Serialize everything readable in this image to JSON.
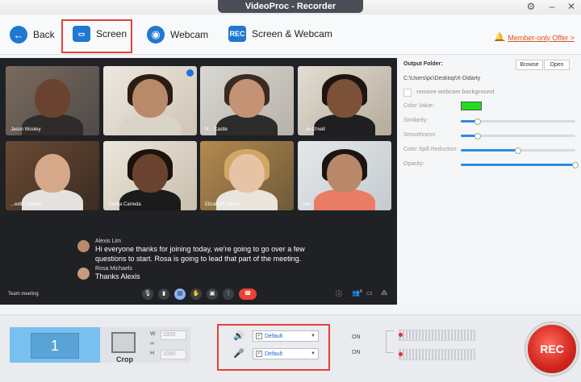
{
  "window": {
    "title": "VideoProc - Recorder"
  },
  "toolbar": {
    "back_label": "Back",
    "screen_label": "Screen",
    "webcam_label": "Webcam",
    "screen_webcam_label": "Screen & Webcam",
    "rec_badge": "REC",
    "member_offer": "Member-only Offer >"
  },
  "meeting": {
    "participants": [
      {
        "name": "Jason Wooley"
      },
      {
        "name": ""
      },
      {
        "name": "N... Castle"
      },
      {
        "name": "...ie O'neill"
      },
      {
        "name": "...edith Jordan"
      },
      {
        "name": "Taisha Carreda"
      },
      {
        "name": "Elizabeth Adams"
      },
      {
        "name": "You"
      }
    ],
    "chat": [
      {
        "sender": "Alexis Lim",
        "message": "Hi everyone thanks for joining today, we're going to go over a few questions to start. Rosa is going to lead that part of the meeting."
      },
      {
        "sender": "Rosa Michaels",
        "message": "Thanks Alexis"
      }
    ],
    "label": "Team meeting",
    "people_count": "8"
  },
  "panel": {
    "output_folder_label": "Output Folder:",
    "browse_label": "Browse",
    "open_label": "Open",
    "path": "C:\\Users\\pc\\Desktop\\X-Didarty",
    "remove_bg_label": "remove webcam background",
    "color_value_label": "Color Value:",
    "color_value": "#22dd22",
    "similarity_label": "Similarity:",
    "smoothness_label": "Smoothness:",
    "spill_label": "Color Spill Reduction:",
    "opacity_label": "Opacity:",
    "similarity": 0.15,
    "smoothness": 0.15,
    "spill": 0.5,
    "opacity": 1.0
  },
  "bottom": {
    "monitor_number": "1",
    "crop_label": "Crop",
    "w_label": "W",
    "h_label": "H",
    "w_value": "1920",
    "h_value": "1080",
    "speaker_device": "Default",
    "mic_device": "Default",
    "speaker_state": "ON",
    "mic_state": "ON",
    "rec_label": "REC"
  },
  "colors": {
    "accent": "#1f78d1",
    "highlight": "#e3413b",
    "rec": "#d1251c"
  }
}
